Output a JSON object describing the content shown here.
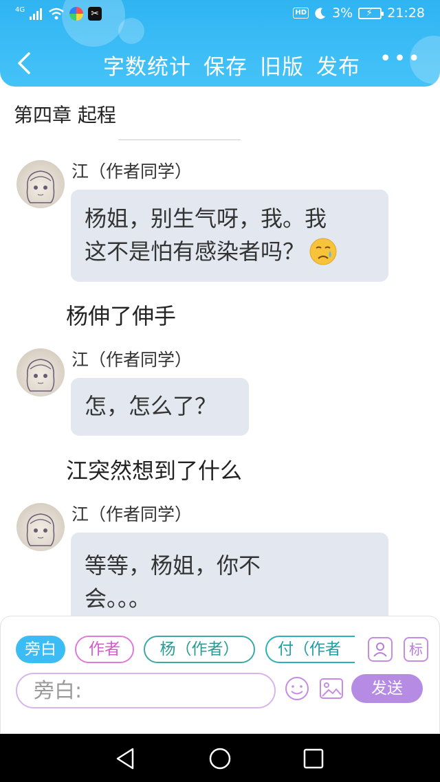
{
  "status_bar": {
    "network": "4G",
    "hd": "HD",
    "battery": "3%",
    "time": "21:28"
  },
  "toolbar": {
    "back_icon": "chevron-left-icon",
    "word_count_label": "字数统计",
    "save_label": "保存",
    "old_version_label": "旧版",
    "publish_label": "发布",
    "more_label": "•••",
    "color": "#3cbcf4"
  },
  "chapter": {
    "title": "第四章 起程"
  },
  "messages": [
    {
      "type": "dialogue",
      "speaker": "江（作者同学）",
      "line1": "杨姐，别生气呀，我。我",
      "line2": "这不是怕有感染者吗？",
      "emoji": "crying-face-icon"
    },
    {
      "type": "narration",
      "text": "杨伸了伸手"
    },
    {
      "type": "dialogue",
      "speaker": "江（作者同学）",
      "line1": "怎，怎么了？"
    },
    {
      "type": "narration",
      "text": "江突然想到了什么"
    },
    {
      "type": "dialogue",
      "speaker": "江（作者同学）",
      "line1": "等等，杨姐，你不",
      "line2": "会。。。"
    }
  ],
  "role_chips": [
    {
      "label": "旁白",
      "selected": true
    },
    {
      "label": "作者",
      "selected": false
    },
    {
      "label": "杨（作者）",
      "selected": false
    },
    {
      "label": "付（作者",
      "selected": false
    }
  ],
  "panel": {
    "role_manage_icon": "person-card-icon",
    "tag_label": "标",
    "input_placeholder": "旁白:",
    "emoji_icon": "smiley-icon",
    "image_icon": "image-icon",
    "send_label": "发送",
    "accent": "#b68be3"
  }
}
